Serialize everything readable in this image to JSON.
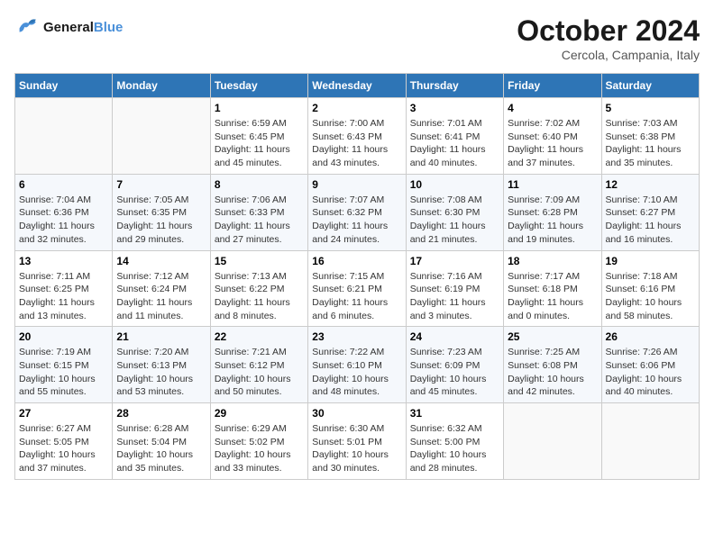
{
  "logo": {
    "line1": "General",
    "line2": "Blue"
  },
  "title": "October 2024",
  "location": "Cercola, Campania, Italy",
  "weekdays": [
    "Sunday",
    "Monday",
    "Tuesday",
    "Wednesday",
    "Thursday",
    "Friday",
    "Saturday"
  ],
  "weeks": [
    [
      {
        "day": "",
        "sunrise": "",
        "sunset": "",
        "daylight": ""
      },
      {
        "day": "",
        "sunrise": "",
        "sunset": "",
        "daylight": ""
      },
      {
        "day": "1",
        "sunrise": "Sunrise: 6:59 AM",
        "sunset": "Sunset: 6:45 PM",
        "daylight": "Daylight: 11 hours and 45 minutes."
      },
      {
        "day": "2",
        "sunrise": "Sunrise: 7:00 AM",
        "sunset": "Sunset: 6:43 PM",
        "daylight": "Daylight: 11 hours and 43 minutes."
      },
      {
        "day": "3",
        "sunrise": "Sunrise: 7:01 AM",
        "sunset": "Sunset: 6:41 PM",
        "daylight": "Daylight: 11 hours and 40 minutes."
      },
      {
        "day": "4",
        "sunrise": "Sunrise: 7:02 AM",
        "sunset": "Sunset: 6:40 PM",
        "daylight": "Daylight: 11 hours and 37 minutes."
      },
      {
        "day": "5",
        "sunrise": "Sunrise: 7:03 AM",
        "sunset": "Sunset: 6:38 PM",
        "daylight": "Daylight: 11 hours and 35 minutes."
      }
    ],
    [
      {
        "day": "6",
        "sunrise": "Sunrise: 7:04 AM",
        "sunset": "Sunset: 6:36 PM",
        "daylight": "Daylight: 11 hours and 32 minutes."
      },
      {
        "day": "7",
        "sunrise": "Sunrise: 7:05 AM",
        "sunset": "Sunset: 6:35 PM",
        "daylight": "Daylight: 11 hours and 29 minutes."
      },
      {
        "day": "8",
        "sunrise": "Sunrise: 7:06 AM",
        "sunset": "Sunset: 6:33 PM",
        "daylight": "Daylight: 11 hours and 27 minutes."
      },
      {
        "day": "9",
        "sunrise": "Sunrise: 7:07 AM",
        "sunset": "Sunset: 6:32 PM",
        "daylight": "Daylight: 11 hours and 24 minutes."
      },
      {
        "day": "10",
        "sunrise": "Sunrise: 7:08 AM",
        "sunset": "Sunset: 6:30 PM",
        "daylight": "Daylight: 11 hours and 21 minutes."
      },
      {
        "day": "11",
        "sunrise": "Sunrise: 7:09 AM",
        "sunset": "Sunset: 6:28 PM",
        "daylight": "Daylight: 11 hours and 19 minutes."
      },
      {
        "day": "12",
        "sunrise": "Sunrise: 7:10 AM",
        "sunset": "Sunset: 6:27 PM",
        "daylight": "Daylight: 11 hours and 16 minutes."
      }
    ],
    [
      {
        "day": "13",
        "sunrise": "Sunrise: 7:11 AM",
        "sunset": "Sunset: 6:25 PM",
        "daylight": "Daylight: 11 hours and 13 minutes."
      },
      {
        "day": "14",
        "sunrise": "Sunrise: 7:12 AM",
        "sunset": "Sunset: 6:24 PM",
        "daylight": "Daylight: 11 hours and 11 minutes."
      },
      {
        "day": "15",
        "sunrise": "Sunrise: 7:13 AM",
        "sunset": "Sunset: 6:22 PM",
        "daylight": "Daylight: 11 hours and 8 minutes."
      },
      {
        "day": "16",
        "sunrise": "Sunrise: 7:15 AM",
        "sunset": "Sunset: 6:21 PM",
        "daylight": "Daylight: 11 hours and 6 minutes."
      },
      {
        "day": "17",
        "sunrise": "Sunrise: 7:16 AM",
        "sunset": "Sunset: 6:19 PM",
        "daylight": "Daylight: 11 hours and 3 minutes."
      },
      {
        "day": "18",
        "sunrise": "Sunrise: 7:17 AM",
        "sunset": "Sunset: 6:18 PM",
        "daylight": "Daylight: 11 hours and 0 minutes."
      },
      {
        "day": "19",
        "sunrise": "Sunrise: 7:18 AM",
        "sunset": "Sunset: 6:16 PM",
        "daylight": "Daylight: 10 hours and 58 minutes."
      }
    ],
    [
      {
        "day": "20",
        "sunrise": "Sunrise: 7:19 AM",
        "sunset": "Sunset: 6:15 PM",
        "daylight": "Daylight: 10 hours and 55 minutes."
      },
      {
        "day": "21",
        "sunrise": "Sunrise: 7:20 AM",
        "sunset": "Sunset: 6:13 PM",
        "daylight": "Daylight: 10 hours and 53 minutes."
      },
      {
        "day": "22",
        "sunrise": "Sunrise: 7:21 AM",
        "sunset": "Sunset: 6:12 PM",
        "daylight": "Daylight: 10 hours and 50 minutes."
      },
      {
        "day": "23",
        "sunrise": "Sunrise: 7:22 AM",
        "sunset": "Sunset: 6:10 PM",
        "daylight": "Daylight: 10 hours and 48 minutes."
      },
      {
        "day": "24",
        "sunrise": "Sunrise: 7:23 AM",
        "sunset": "Sunset: 6:09 PM",
        "daylight": "Daylight: 10 hours and 45 minutes."
      },
      {
        "day": "25",
        "sunrise": "Sunrise: 7:25 AM",
        "sunset": "Sunset: 6:08 PM",
        "daylight": "Daylight: 10 hours and 42 minutes."
      },
      {
        "day": "26",
        "sunrise": "Sunrise: 7:26 AM",
        "sunset": "Sunset: 6:06 PM",
        "daylight": "Daylight: 10 hours and 40 minutes."
      }
    ],
    [
      {
        "day": "27",
        "sunrise": "Sunrise: 6:27 AM",
        "sunset": "Sunset: 5:05 PM",
        "daylight": "Daylight: 10 hours and 37 minutes."
      },
      {
        "day": "28",
        "sunrise": "Sunrise: 6:28 AM",
        "sunset": "Sunset: 5:04 PM",
        "daylight": "Daylight: 10 hours and 35 minutes."
      },
      {
        "day": "29",
        "sunrise": "Sunrise: 6:29 AM",
        "sunset": "Sunset: 5:02 PM",
        "daylight": "Daylight: 10 hours and 33 minutes."
      },
      {
        "day": "30",
        "sunrise": "Sunrise: 6:30 AM",
        "sunset": "Sunset: 5:01 PM",
        "daylight": "Daylight: 10 hours and 30 minutes."
      },
      {
        "day": "31",
        "sunrise": "Sunrise: 6:32 AM",
        "sunset": "Sunset: 5:00 PM",
        "daylight": "Daylight: 10 hours and 28 minutes."
      },
      {
        "day": "",
        "sunrise": "",
        "sunset": "",
        "daylight": ""
      },
      {
        "day": "",
        "sunrise": "",
        "sunset": "",
        "daylight": ""
      }
    ]
  ]
}
